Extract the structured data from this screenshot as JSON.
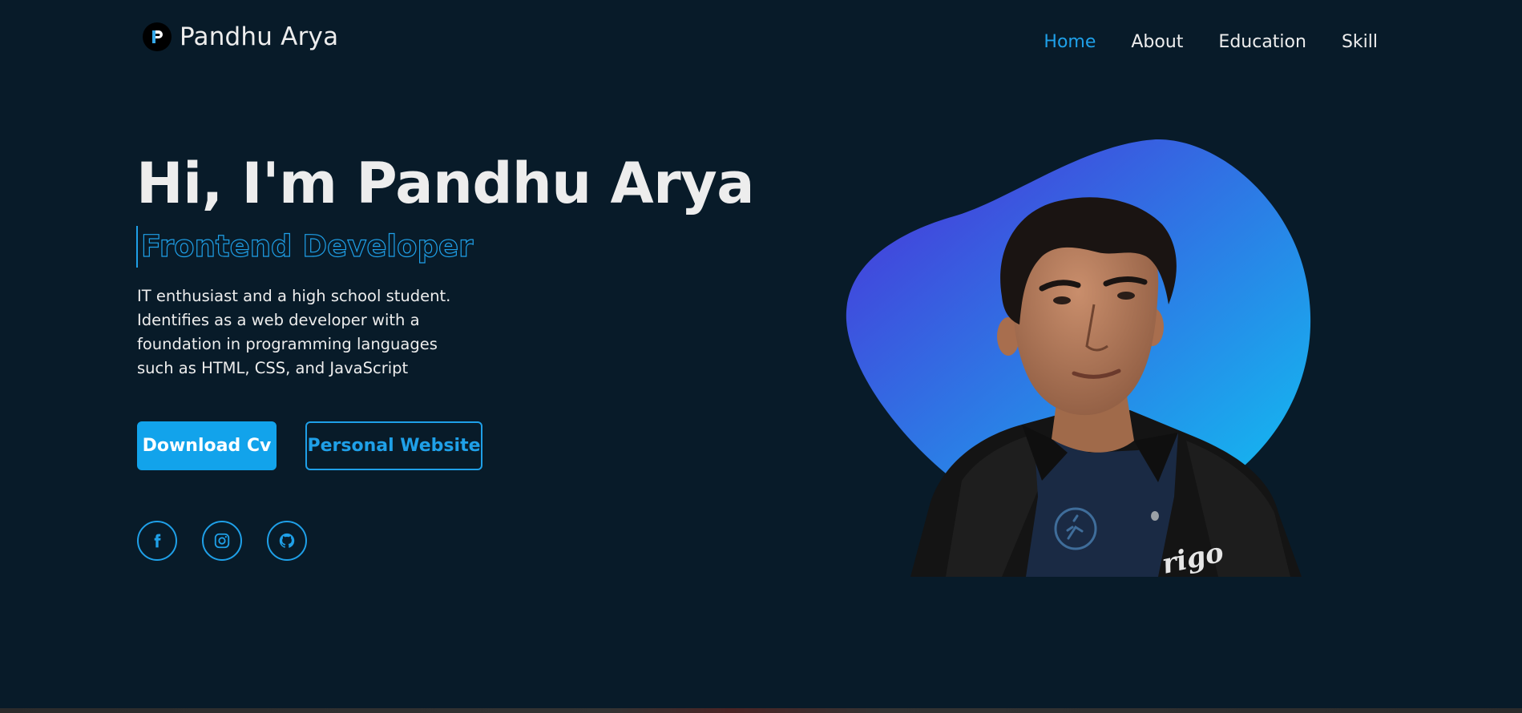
{
  "header": {
    "logo_text": "Pandhu Arya",
    "nav": [
      {
        "label": "Home",
        "active": true
      },
      {
        "label": "About",
        "active": false
      },
      {
        "label": "Education",
        "active": false
      },
      {
        "label": "Skill",
        "active": false
      }
    ]
  },
  "hero": {
    "title": "Hi, I'm Pandhu Arya",
    "role": "Frontend Developer",
    "description": "IT enthusiast and a high school student. Identifies as a web developer with a foundation in programming languages such as HTML, CSS, and JavaScript",
    "buttons": {
      "download_cv": "Download Cv",
      "personal_website": "Personal Website"
    },
    "socials": [
      {
        "icon": "facebook-icon"
      },
      {
        "icon": "instagram-icon"
      },
      {
        "icon": "github-icon"
      }
    ],
    "shirt_print": "rigo"
  },
  "colors": {
    "background": "#081b29",
    "accent": "#1fa0e8",
    "text": "#ededed",
    "blob_start": "#4b2fd8",
    "blob_end": "#0fc4f2"
  }
}
